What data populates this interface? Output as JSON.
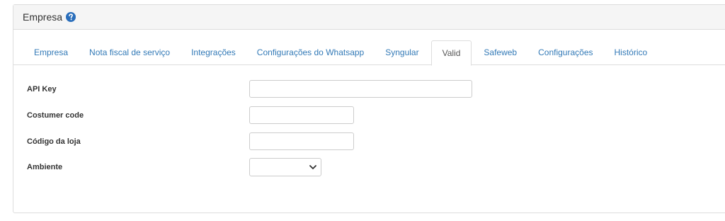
{
  "panel": {
    "title": "Empresa",
    "help_icon": "question-circle-icon"
  },
  "tabs": [
    {
      "label": "Empresa",
      "active": false
    },
    {
      "label": "Nota fiscal de serviço",
      "active": false
    },
    {
      "label": "Integrações",
      "active": false
    },
    {
      "label": "Configurações do Whatsapp",
      "active": false
    },
    {
      "label": "Syngular",
      "active": false
    },
    {
      "label": "Valid",
      "active": true
    },
    {
      "label": "Safeweb",
      "active": false
    },
    {
      "label": "Configurações",
      "active": false
    },
    {
      "label": "Histórico",
      "active": false
    }
  ],
  "form": {
    "api_key": {
      "label": "API Key",
      "value": ""
    },
    "costumer_code": {
      "label": "Costumer code",
      "value": ""
    },
    "codigo_loja": {
      "label": "Código da loja",
      "value": ""
    },
    "ambiente": {
      "label": "Ambiente",
      "value": ""
    }
  },
  "colors": {
    "link": "#337ab7",
    "help_icon": "#2a6ebb",
    "heading_bg": "#f5f5f5",
    "border": "#dddddd"
  }
}
